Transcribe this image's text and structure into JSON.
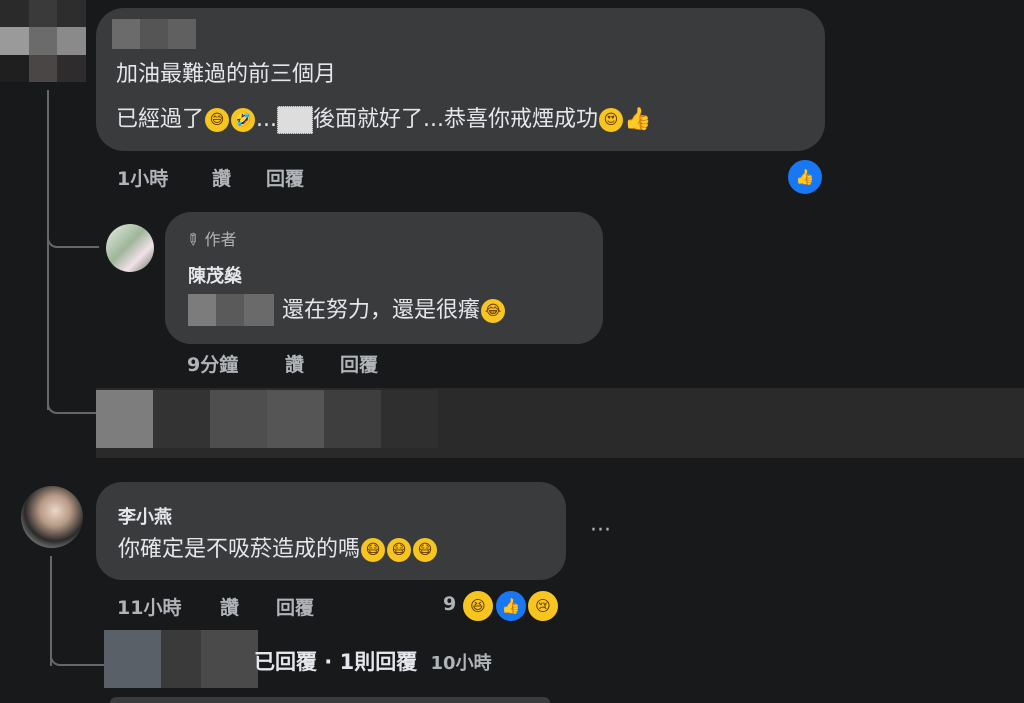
{
  "comment1": {
    "line1": "加油最難過的前三個月",
    "line2_text_a": "已經過了",
    "line2_text_b": "...",
    "line2_text_c": "後面就好了...恭喜你戒煙成功",
    "time": "1小時",
    "like_label": "讚",
    "reply_label": "回覆",
    "emojis": [
      "grinning-sweat",
      "rofl",
      "heart-eyes",
      "thumbs-up"
    ]
  },
  "reply1": {
    "badge_label": "作者",
    "name": "陳茂燊",
    "text": "還在努力，還是很癢",
    "time": "9分鐘",
    "like_label": "讚",
    "reply_label": "回覆"
  },
  "comment2": {
    "name": "李小燕",
    "text": "你確定是不吸菸造成的嗎",
    "time": "11小時",
    "like_label": "讚",
    "reply_label": "回覆",
    "reaction_count": "9",
    "more_label": "···",
    "replies_summary": "已回覆 · 1則回覆",
    "replies_time": "10小時"
  },
  "colors": {
    "background": "#18191a",
    "bubble": "#3a3b3c",
    "text": "#e4e6eb",
    "meta": "#b0b3b8",
    "like_blue": "#1877f2"
  }
}
